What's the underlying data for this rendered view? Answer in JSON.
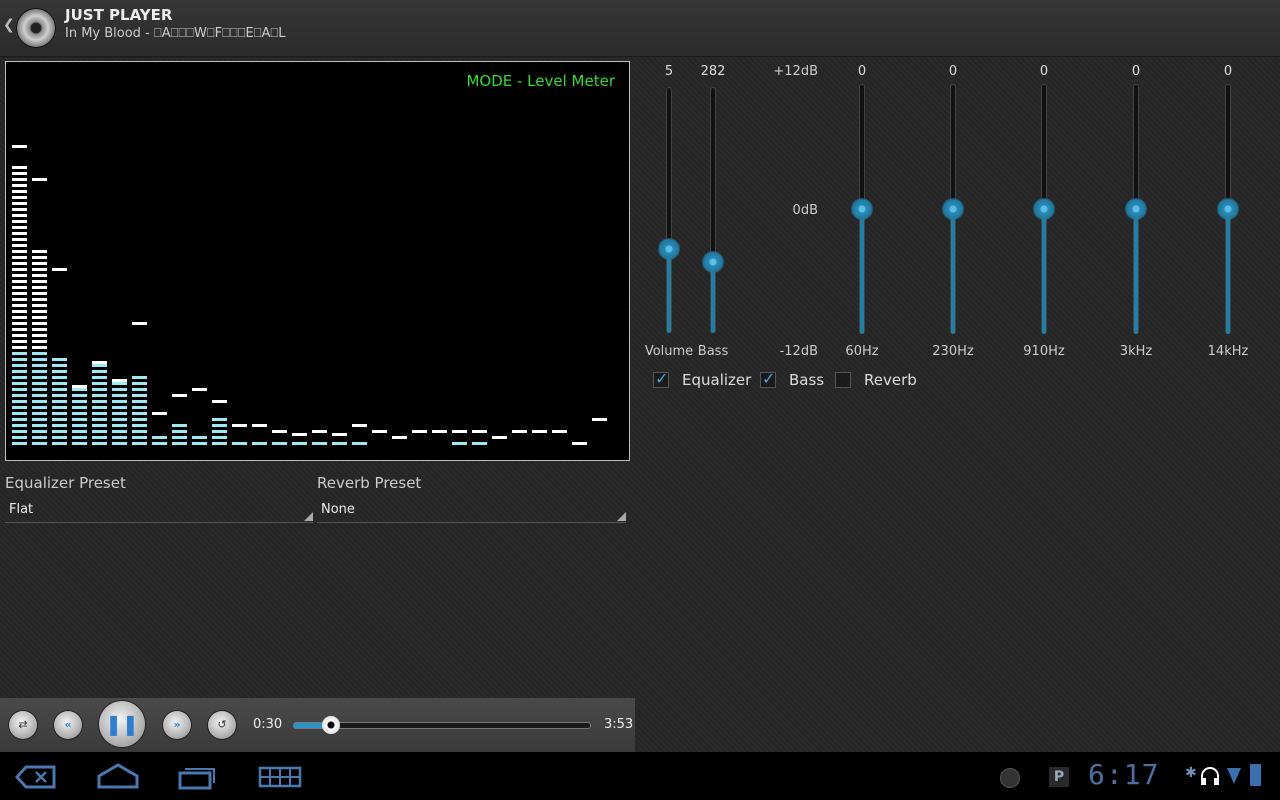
{
  "app": {
    "title": "JUST PLAYER",
    "track": "In My Blood - ⎕A⎕⎕⎕W⎕F⎕⎕⎕E⎕A⎕L"
  },
  "visualizer": {
    "mode": "MODE - Level Meter",
    "bars": [
      {
        "level": 0.95,
        "peak": 1.0
      },
      {
        "level": 0.66,
        "peak": 0.89
      },
      {
        "level": 0.3,
        "peak": 0.59
      },
      {
        "level": 0.2,
        "peak": 0.2
      },
      {
        "level": 0.28,
        "peak": 0.28
      },
      {
        "level": 0.22,
        "peak": 0.22
      },
      {
        "level": 0.24,
        "peak": 0.41
      },
      {
        "level": 0.04,
        "peak": 0.11
      },
      {
        "level": 0.08,
        "peak": 0.17
      },
      {
        "level": 0.04,
        "peak": 0.19
      },
      {
        "level": 0.1,
        "peak": 0.15
      },
      {
        "level": 0.02,
        "peak": 0.07
      },
      {
        "level": 0.03,
        "peak": 0.07
      },
      {
        "level": 0.02,
        "peak": 0.05
      },
      {
        "level": 0.02,
        "peak": 0.04
      },
      {
        "level": 0.02,
        "peak": 0.05
      },
      {
        "level": 0.02,
        "peak": 0.04
      },
      {
        "level": 0.02,
        "peak": 0.07
      },
      {
        "level": 0.0,
        "peak": 0.05
      },
      {
        "level": 0.0,
        "peak": 0.03
      },
      {
        "level": 0.0,
        "peak": 0.05
      },
      {
        "level": 0.0,
        "peak": 0.05
      },
      {
        "level": 0.02,
        "peak": 0.05
      },
      {
        "level": 0.02,
        "peak": 0.05
      },
      {
        "level": 0.0,
        "peak": 0.03
      },
      {
        "level": 0.0,
        "peak": 0.05
      },
      {
        "level": 0.0,
        "peak": 0.05
      },
      {
        "level": 0.0,
        "peak": 0.05
      },
      {
        "level": 0.0,
        "peak": 0.01
      },
      {
        "level": 0.0,
        "peak": 0.09
      }
    ]
  },
  "presets": {
    "equalizer": {
      "label": "Equalizer Preset",
      "value": "Flat"
    },
    "reverb": {
      "label": "Reverb Preset",
      "value": "None"
    }
  },
  "controls": {
    "volume": {
      "label": "Volume",
      "value": "5",
      "level": 0.34
    },
    "bass": {
      "label": "Bass",
      "value": "282",
      "level": 0.29
    },
    "db_top": "+12dB",
    "db_mid": "0dB",
    "db_bottom": "-12dB",
    "bands": [
      {
        "label": "60Hz",
        "value": "0",
        "level": 0.5
      },
      {
        "label": "230Hz",
        "value": "0",
        "level": 0.5
      },
      {
        "label": "910Hz",
        "value": "0",
        "level": 0.5
      },
      {
        "label": "3kHz",
        "value": "0",
        "level": 0.5
      },
      {
        "label": "14kHz",
        "value": "0",
        "level": 0.5
      }
    ],
    "checks": [
      {
        "label": "Equalizer",
        "checked": true
      },
      {
        "label": "Bass",
        "checked": true
      },
      {
        "label": "Reverb",
        "checked": false
      }
    ]
  },
  "transport": {
    "elapsed": "0:30",
    "total": "3:53",
    "progress": 0.13
  },
  "status": {
    "clock": "6:17"
  },
  "colors": {
    "accent": "#2a8ab6",
    "mode_text": "#33dd33",
    "bar_peak": "#ffffff",
    "bar_low": "#9be9f4"
  }
}
